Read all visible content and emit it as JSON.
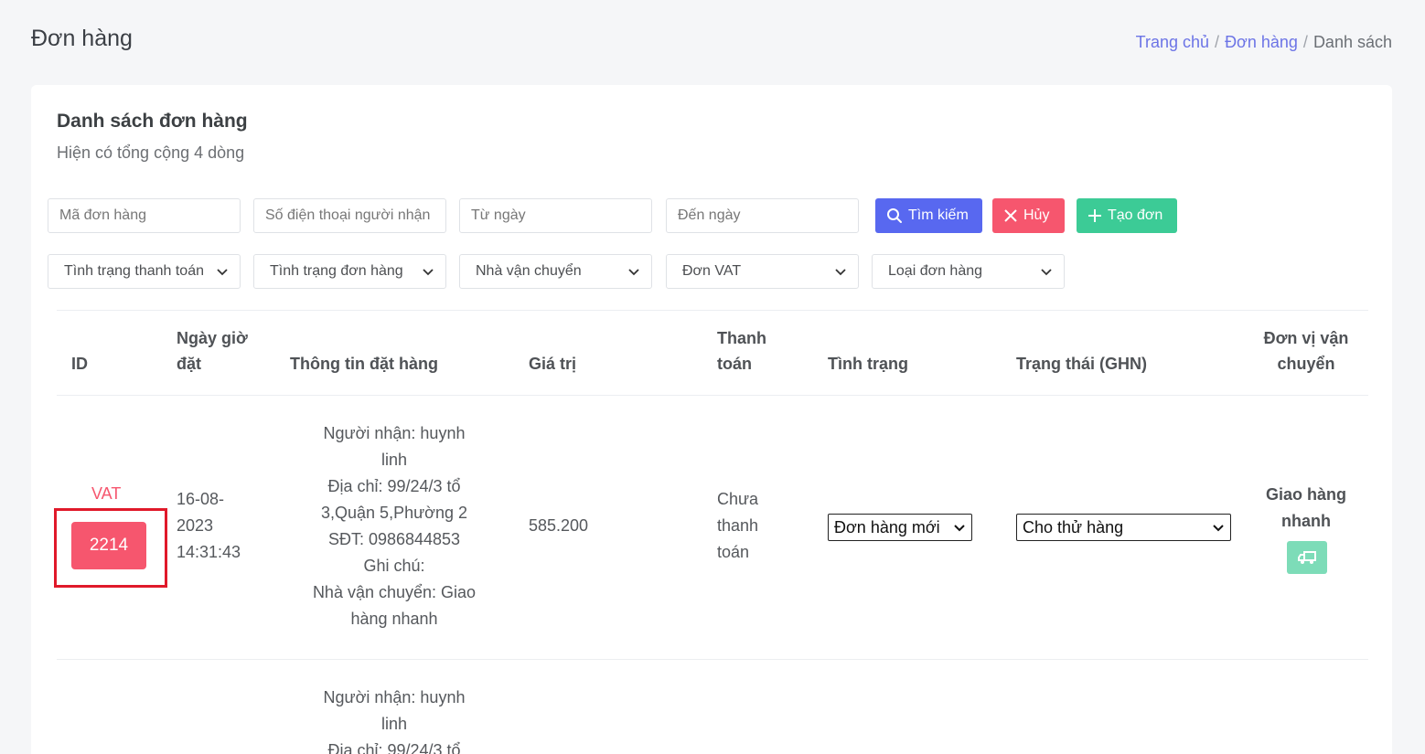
{
  "header": {
    "title": "Đơn hàng",
    "breadcrumb": {
      "home": "Trang chủ",
      "section": "Đơn hàng",
      "current": "Danh sách"
    }
  },
  "card": {
    "title": "Danh sách đơn hàng",
    "subtitle": "Hiện có tổng cộng 4 dòng"
  },
  "filters": {
    "order_code_placeholder": "Mã đơn hàng",
    "phone_placeholder": "Số điện thoại người nhận",
    "from_date_placeholder": "Từ ngày",
    "to_date_placeholder": "Đến ngày",
    "payment_status": "Tình trạng thanh toán",
    "order_status": "Tình trạng đơn hàng",
    "carrier": "Nhà vận chuyển",
    "vat": "Đơn VAT",
    "order_type": "Loại đơn hàng"
  },
  "buttons": {
    "search": "Tìm kiếm",
    "cancel": "Hủy",
    "create": "Tạo đơn"
  },
  "table": {
    "headers": {
      "id": "ID",
      "datetime_1": "Ngày giờ",
      "datetime_2": "đặt",
      "order_info": "Thông tin đặt hàng",
      "value": "Giá trị",
      "payment_1": "Thanh",
      "payment_2": "toán",
      "status": "Tình trạng",
      "ghn_status": "Trạng thái (GHN)",
      "carrier_1": "Đơn vị vận",
      "carrier_2": "chuyển"
    },
    "rows": [
      {
        "vat": "VAT",
        "id": "2214",
        "date_1": "16-08-",
        "date_2": "2023",
        "time": "14:31:43",
        "info": [
          "Người nhận: huynh",
          "linh",
          "Địa chỉ: 99/24/3 tổ",
          "3,Quận 5,Phường 2",
          "SĐT: 0986844853",
          "Ghi chú:",
          "Nhà vận chuyển: Giao",
          "hàng nhanh"
        ],
        "value": "585.200",
        "payment": [
          "Chưa",
          "thanh",
          "toán"
        ],
        "status_selected": "Đơn hàng mới",
        "ghn_selected": "Cho thử hàng",
        "carrier": [
          "Giao hàng",
          "nhanh"
        ]
      },
      {
        "info": [
          "Người nhận: huynh",
          "linh",
          "Địa chỉ: 99/24/3 tổ"
        ]
      }
    ]
  }
}
